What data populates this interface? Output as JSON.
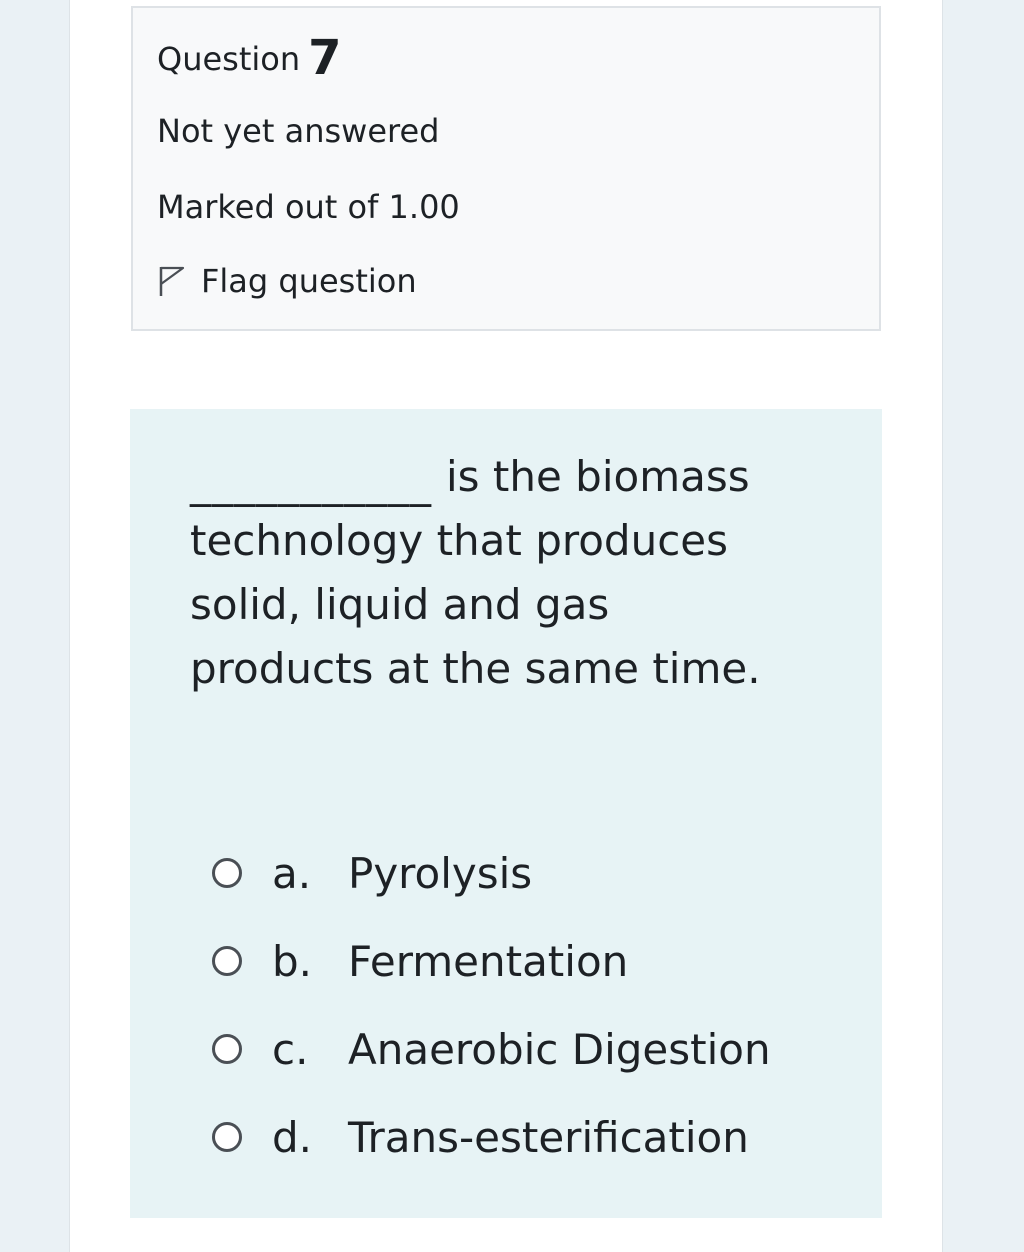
{
  "question_info": {
    "label": "Question",
    "number": "7",
    "state": "Not yet answered",
    "grade": "Marked out of 1.00",
    "flag_label": "Flag question",
    "flag_icon": "flag-outline-icon"
  },
  "question": {
    "blank": "___________",
    "text_after_blank": "is the biomass technology that produces solid, liquid and gas products at the same time."
  },
  "answers": [
    {
      "letter": "a.",
      "text": "Pyrolysis"
    },
    {
      "letter": "b.",
      "text": "Fermentation"
    },
    {
      "letter": "c.",
      "text": "Anaerobic Digestion"
    },
    {
      "letter": "d.",
      "text": "Trans-esterification"
    }
  ],
  "colors": {
    "page_side": "#eaf1f5",
    "info_bg": "#f8f9fa",
    "formulation_bg": "#e7f3f5",
    "text": "#1d2125"
  }
}
